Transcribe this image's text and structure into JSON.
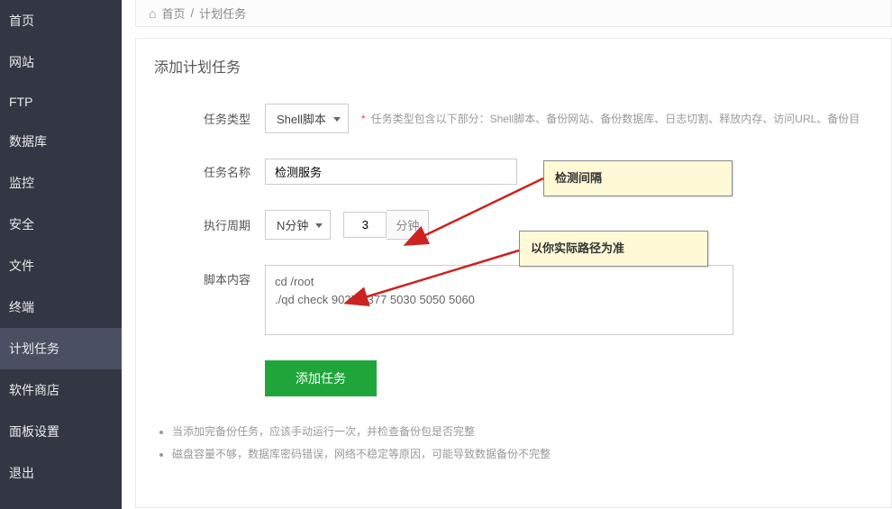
{
  "sidebar": {
    "items": [
      {
        "label": "首页"
      },
      {
        "label": "网站"
      },
      {
        "label": "FTP"
      },
      {
        "label": "数据库"
      },
      {
        "label": "监控"
      },
      {
        "label": "安全"
      },
      {
        "label": "文件"
      },
      {
        "label": "终端"
      },
      {
        "label": "计划任务",
        "active": true
      },
      {
        "label": "软件商店"
      },
      {
        "label": "面板设置"
      },
      {
        "label": "退出"
      }
    ]
  },
  "breadcrumb": {
    "home": "首页",
    "current": "计划任务"
  },
  "page": {
    "title": "添加计划任务"
  },
  "form": {
    "task_type": {
      "label": "任务类型",
      "value": "Shell脚本"
    },
    "task_type_hint": "任务类型包含以下部分：Shell脚本、备份网站、备份数据库、日志切割、释放内存、访问URL、备份目",
    "task_name": {
      "label": "任务名称",
      "value": "检测服务"
    },
    "period": {
      "label": "执行周期",
      "value": "N分钟",
      "num": "3",
      "unit": "分钟"
    },
    "script": {
      "label": "脚本内容",
      "value": "cd /root\n./qd check 9027 7377 5030 5050 5060"
    },
    "submit": "添加任务"
  },
  "notes": {
    "items": [
      "当添加完备份任务，应该手动运行一次，并检查备份包是否完整",
      "磁盘容量不够，数据库密码错误，网络不稳定等原因，可能导致数据备份不完整"
    ]
  },
  "callouts": {
    "a": "检测间隔",
    "b": "以你实际路径为准"
  }
}
